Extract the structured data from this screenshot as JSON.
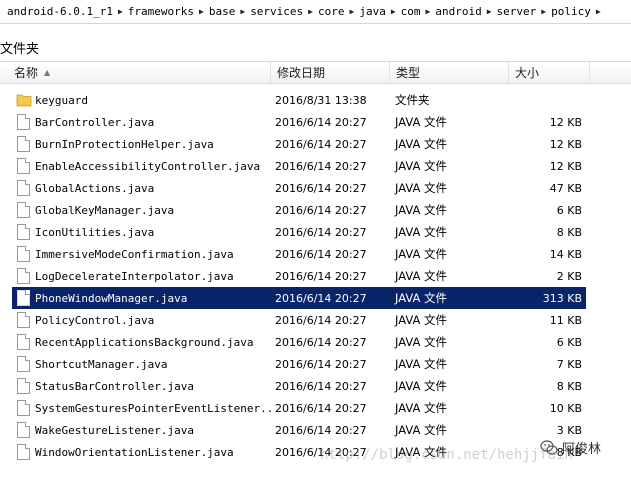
{
  "breadcrumb": [
    "android-6.0.1_r1",
    "frameworks",
    "base",
    "services",
    "core",
    "java",
    "com",
    "android",
    "server",
    "policy"
  ],
  "folder_label": "文件夹",
  "columns": {
    "name": "名称",
    "date": "修改日期",
    "type": "类型",
    "size": "大小"
  },
  "rows": [
    {
      "name": "keyguard",
      "date": "2016/8/31 13:38",
      "type": "文件夹",
      "size": "",
      "icon": "folder-icon"
    },
    {
      "name": "BarController.java",
      "date": "2016/6/14 20:27",
      "type": "JAVA 文件",
      "size": "12 KB",
      "icon": "file-icon"
    },
    {
      "name": "BurnInProtectionHelper.java",
      "date": "2016/6/14 20:27",
      "type": "JAVA 文件",
      "size": "12 KB",
      "icon": "file-icon"
    },
    {
      "name": "EnableAccessibilityController.java",
      "date": "2016/6/14 20:27",
      "type": "JAVA 文件",
      "size": "12 KB",
      "icon": "file-icon"
    },
    {
      "name": "GlobalActions.java",
      "date": "2016/6/14 20:27",
      "type": "JAVA 文件",
      "size": "47 KB",
      "icon": "file-icon"
    },
    {
      "name": "GlobalKeyManager.java",
      "date": "2016/6/14 20:27",
      "type": "JAVA 文件",
      "size": "6 KB",
      "icon": "file-icon"
    },
    {
      "name": "IconUtilities.java",
      "date": "2016/6/14 20:27",
      "type": "JAVA 文件",
      "size": "8 KB",
      "icon": "file-icon"
    },
    {
      "name": "ImmersiveModeConfirmation.java",
      "date": "2016/6/14 20:27",
      "type": "JAVA 文件",
      "size": "14 KB",
      "icon": "file-icon"
    },
    {
      "name": "LogDecelerateInterpolator.java",
      "date": "2016/6/14 20:27",
      "type": "JAVA 文件",
      "size": "2 KB",
      "icon": "file-icon"
    },
    {
      "name": "PhoneWindowManager.java",
      "date": "2016/6/14 20:27",
      "type": "JAVA 文件",
      "size": "313 KB",
      "icon": "file-icon",
      "selected": true
    },
    {
      "name": "PolicyControl.java",
      "date": "2016/6/14 20:27",
      "type": "JAVA 文件",
      "size": "11 KB",
      "icon": "file-icon"
    },
    {
      "name": "RecentApplicationsBackground.java",
      "date": "2016/6/14 20:27",
      "type": "JAVA 文件",
      "size": "6 KB",
      "icon": "file-icon"
    },
    {
      "name": "ShortcutManager.java",
      "date": "2016/6/14 20:27",
      "type": "JAVA 文件",
      "size": "7 KB",
      "icon": "file-icon"
    },
    {
      "name": "StatusBarController.java",
      "date": "2016/6/14 20:27",
      "type": "JAVA 文件",
      "size": "8 KB",
      "icon": "file-icon"
    },
    {
      "name": "SystemGesturesPointerEventListener...",
      "date": "2016/6/14 20:27",
      "type": "JAVA 文件",
      "size": "10 KB",
      "icon": "file-icon"
    },
    {
      "name": "WakeGestureListener.java",
      "date": "2016/6/14 20:27",
      "type": "JAVA 文件",
      "size": "3 KB",
      "icon": "file-icon"
    },
    {
      "name": "WindowOrientationListener.java",
      "date": "2016/6/14 20:27",
      "type": "JAVA 文件",
      "size": "8 KB",
      "icon": "file-icon"
    }
  ],
  "watermark": "http://blog.csdn.net/hehjjfain",
  "wechat_mark": "阿俊林",
  "colors": {
    "selection": "#0a246a",
    "folder": "#f5c74a"
  }
}
